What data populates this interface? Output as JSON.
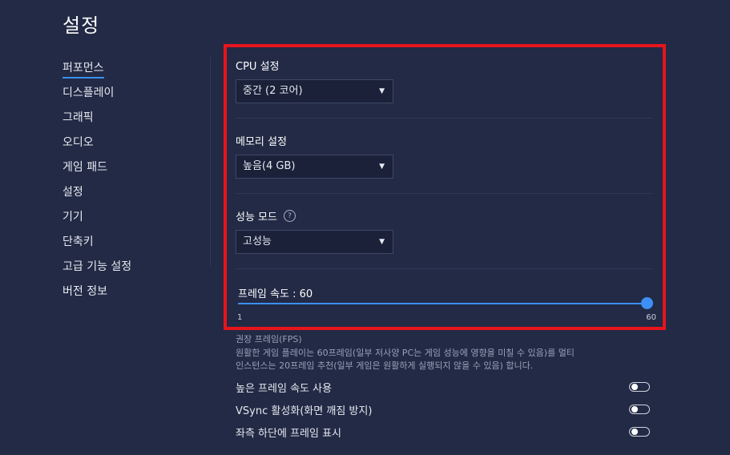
{
  "page": {
    "title": "설정"
  },
  "sidebar": {
    "items": [
      {
        "label": "퍼포먼스",
        "active": true
      },
      {
        "label": "디스플레이"
      },
      {
        "label": "그래픽"
      },
      {
        "label": "오디오"
      },
      {
        "label": "게임 패드"
      },
      {
        "label": "설정"
      },
      {
        "label": "기기"
      },
      {
        "label": "단축키"
      },
      {
        "label": "고급 기능 설정"
      },
      {
        "label": "버전 정보"
      }
    ]
  },
  "performance": {
    "cpu": {
      "label": "CPU 설정",
      "value": "중간 (2 코어)"
    },
    "memory": {
      "label": "메모리 설정",
      "value": "높음(4 GB)"
    },
    "mode": {
      "label": "성능 모드",
      "value": "고성능"
    },
    "fps": {
      "label": "프레임 속도 : 60",
      "value": 60,
      "min": 1,
      "max": 60,
      "min_label": "1",
      "max_label": "60"
    }
  },
  "recommended": {
    "title": "권장 프레임(FPS)",
    "line1": "원활한 게임 플레이는 60프레임(일부 저사양 PC는 게임 성능에 영향을 미칠 수 있음)를 멀티",
    "line2": "인스턴스는 20프레임 추천(일부 게임은 원활하게 실행되지 않을 수 있음) 합니다."
  },
  "toggles": [
    {
      "label": "높은 프레임 속도 사용",
      "enabled": false
    },
    {
      "label": "VSync 활성화(화면 깨짐 방지)",
      "enabled": false
    },
    {
      "label": "좌측 하단에 프레임 표시",
      "enabled": false
    }
  ],
  "colors": {
    "background": "#222a45",
    "accent": "#3d8ff5",
    "highlight_border": "#e8141c"
  }
}
